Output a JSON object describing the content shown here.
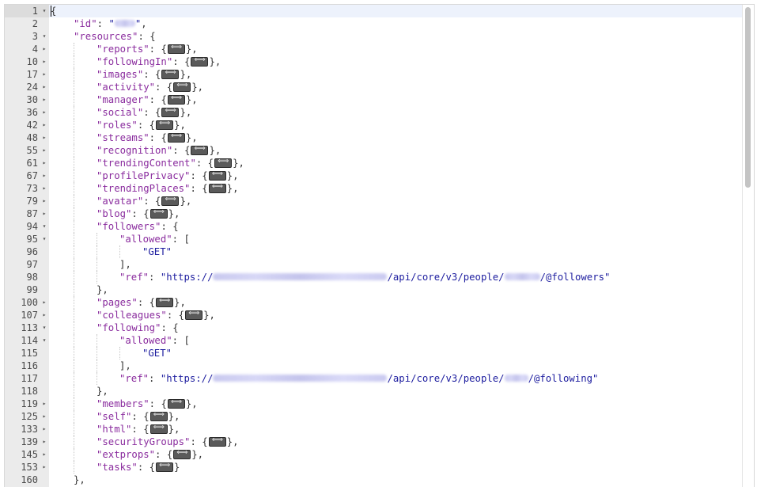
{
  "lines": [
    {
      "n": "1",
      "f": "v",
      "d": 0,
      "t": [
        [
          "p",
          "{"
        ]
      ],
      "active": true
    },
    {
      "n": "2",
      "d": 1,
      "t": [
        [
          "k",
          "\"id\""
        ],
        [
          "p",
          ": "
        ],
        [
          "s",
          "\""
        ],
        [
          "b",
          "redacted"
        ],
        [
          "s",
          "\""
        ],
        [
          "p",
          ","
        ]
      ]
    },
    {
      "n": "3",
      "f": "v",
      "d": 1,
      "t": [
        [
          "k",
          "\"resources\""
        ],
        [
          "p",
          ": {"
        ]
      ]
    },
    {
      "n": "4",
      "f": ">",
      "d": 2,
      "t": [
        [
          "k",
          "\"reports\""
        ],
        [
          "p",
          ": {"
        ],
        [
          "c",
          "collapsed"
        ],
        [
          "p",
          "},"
        ]
      ]
    },
    {
      "n": "10",
      "f": ">",
      "d": 2,
      "t": [
        [
          "k",
          "\"followingIn\""
        ],
        [
          "p",
          ": {"
        ],
        [
          "c",
          "collapsed"
        ],
        [
          "p",
          "},"
        ]
      ]
    },
    {
      "n": "17",
      "f": ">",
      "d": 2,
      "t": [
        [
          "k",
          "\"images\""
        ],
        [
          "p",
          ": {"
        ],
        [
          "c",
          "collapsed"
        ],
        [
          "p",
          "},"
        ]
      ]
    },
    {
      "n": "24",
      "f": ">",
      "d": 2,
      "t": [
        [
          "k",
          "\"activity\""
        ],
        [
          "p",
          ": {"
        ],
        [
          "c",
          "collapsed"
        ],
        [
          "p",
          "},"
        ]
      ]
    },
    {
      "n": "30",
      "f": ">",
      "d": 2,
      "t": [
        [
          "k",
          "\"manager\""
        ],
        [
          "p",
          ": {"
        ],
        [
          "c",
          "collapsed"
        ],
        [
          "p",
          "},"
        ]
      ]
    },
    {
      "n": "36",
      "f": ">",
      "d": 2,
      "t": [
        [
          "k",
          "\"social\""
        ],
        [
          "p",
          ": {"
        ],
        [
          "c",
          "collapsed"
        ],
        [
          "p",
          "},"
        ]
      ]
    },
    {
      "n": "42",
      "f": ">",
      "d": 2,
      "t": [
        [
          "k",
          "\"roles\""
        ],
        [
          "p",
          ": {"
        ],
        [
          "c",
          "collapsed"
        ],
        [
          "p",
          "},"
        ]
      ]
    },
    {
      "n": "48",
      "f": ">",
      "d": 2,
      "t": [
        [
          "k",
          "\"streams\""
        ],
        [
          "p",
          ": {"
        ],
        [
          "c",
          "collapsed"
        ],
        [
          "p",
          "},"
        ]
      ]
    },
    {
      "n": "55",
      "f": ">",
      "d": 2,
      "t": [
        [
          "k",
          "\"recognition\""
        ],
        [
          "p",
          ": {"
        ],
        [
          "c",
          "collapsed"
        ],
        [
          "p",
          "},"
        ]
      ]
    },
    {
      "n": "61",
      "f": ">",
      "d": 2,
      "t": [
        [
          "k",
          "\"trendingContent\""
        ],
        [
          "p",
          ": {"
        ],
        [
          "c",
          "collapsed"
        ],
        [
          "p",
          "},"
        ]
      ]
    },
    {
      "n": "67",
      "f": ">",
      "d": 2,
      "t": [
        [
          "k",
          "\"profilePrivacy\""
        ],
        [
          "p",
          ": {"
        ],
        [
          "c",
          "collapsed"
        ],
        [
          "p",
          "},"
        ]
      ]
    },
    {
      "n": "73",
      "f": ">",
      "d": 2,
      "t": [
        [
          "k",
          "\"trendingPlaces\""
        ],
        [
          "p",
          ": {"
        ],
        [
          "c",
          "collapsed"
        ],
        [
          "p",
          "},"
        ]
      ]
    },
    {
      "n": "79",
      "f": ">",
      "d": 2,
      "t": [
        [
          "k",
          "\"avatar\""
        ],
        [
          "p",
          ": {"
        ],
        [
          "c",
          "collapsed"
        ],
        [
          "p",
          "},"
        ]
      ]
    },
    {
      "n": "87",
      "f": ">",
      "d": 2,
      "t": [
        [
          "k",
          "\"blog\""
        ],
        [
          "p",
          ": {"
        ],
        [
          "c",
          "collapsed"
        ],
        [
          "p",
          "},"
        ]
      ]
    },
    {
      "n": "94",
      "f": "v",
      "d": 2,
      "t": [
        [
          "k",
          "\"followers\""
        ],
        [
          "p",
          ": {"
        ]
      ]
    },
    {
      "n": "95",
      "f": "v",
      "d": 3,
      "t": [
        [
          "k",
          "\"allowed\""
        ],
        [
          "p",
          ": ["
        ]
      ]
    },
    {
      "n": "96",
      "d": 4,
      "t": [
        [
          "s",
          "\"GET\""
        ]
      ]
    },
    {
      "n": "97",
      "d": 3,
      "t": [
        [
          "p",
          "],"
        ]
      ]
    },
    {
      "n": "98",
      "d": 3,
      "t": [
        [
          "k",
          "\"ref\""
        ],
        [
          "p",
          ": "
        ],
        [
          "s",
          "\"https://"
        ],
        [
          "b",
          "redacted"
        ],
        [
          "s",
          "/api/core/v3/people/"
        ],
        [
          "b",
          "redacted"
        ],
        [
          "s",
          "/@followers\""
        ]
      ]
    },
    {
      "n": "99",
      "d": 2,
      "t": [
        [
          "p",
          "},"
        ]
      ]
    },
    {
      "n": "100",
      "f": ">",
      "d": 2,
      "t": [
        [
          "k",
          "\"pages\""
        ],
        [
          "p",
          ": {"
        ],
        [
          "c",
          "collapsed"
        ],
        [
          "p",
          "},"
        ]
      ]
    },
    {
      "n": "107",
      "f": ">",
      "d": 2,
      "t": [
        [
          "k",
          "\"colleagues\""
        ],
        [
          "p",
          ": {"
        ],
        [
          "c",
          "collapsed"
        ],
        [
          "p",
          "},"
        ]
      ]
    },
    {
      "n": "113",
      "f": "v",
      "d": 2,
      "t": [
        [
          "k",
          "\"following\""
        ],
        [
          "p",
          ": {"
        ]
      ]
    },
    {
      "n": "114",
      "f": "v",
      "d": 3,
      "t": [
        [
          "k",
          "\"allowed\""
        ],
        [
          "p",
          ": ["
        ]
      ]
    },
    {
      "n": "115",
      "d": 4,
      "t": [
        [
          "s",
          "\"GET\""
        ]
      ]
    },
    {
      "n": "116",
      "d": 3,
      "t": [
        [
          "p",
          "],"
        ]
      ]
    },
    {
      "n": "117",
      "d": 3,
      "t": [
        [
          "k",
          "\"ref\""
        ],
        [
          "p",
          ": "
        ],
        [
          "s",
          "\"https://"
        ],
        [
          "b",
          "redacted"
        ],
        [
          "s",
          "/api/core/v3/people/"
        ],
        [
          "b",
          "redacted"
        ],
        [
          "s",
          "/@following\""
        ]
      ]
    },
    {
      "n": "118",
      "d": 2,
      "t": [
        [
          "p",
          "},"
        ]
      ]
    },
    {
      "n": "119",
      "f": ">",
      "d": 2,
      "t": [
        [
          "k",
          "\"members\""
        ],
        [
          "p",
          ": {"
        ],
        [
          "c",
          "collapsed"
        ],
        [
          "p",
          "},"
        ]
      ]
    },
    {
      "n": "125",
      "f": ">",
      "d": 2,
      "t": [
        [
          "k",
          "\"self\""
        ],
        [
          "p",
          ": {"
        ],
        [
          "c",
          "collapsed"
        ],
        [
          "p",
          "},"
        ]
      ]
    },
    {
      "n": "133",
      "f": ">",
      "d": 2,
      "t": [
        [
          "k",
          "\"html\""
        ],
        [
          "p",
          ": {"
        ],
        [
          "c",
          "collapsed"
        ],
        [
          "p",
          "},"
        ]
      ]
    },
    {
      "n": "139",
      "f": ">",
      "d": 2,
      "t": [
        [
          "k",
          "\"securityGroups\""
        ],
        [
          "p",
          ": {"
        ],
        [
          "c",
          "collapsed"
        ],
        [
          "p",
          "},"
        ]
      ]
    },
    {
      "n": "145",
      "f": ">",
      "d": 2,
      "t": [
        [
          "k",
          "\"extprops\""
        ],
        [
          "p",
          ": {"
        ],
        [
          "c",
          "collapsed"
        ],
        [
          "p",
          "},"
        ]
      ]
    },
    {
      "n": "153",
      "f": ">",
      "d": 2,
      "t": [
        [
          "k",
          "\"tasks\""
        ],
        [
          "p",
          ": {"
        ],
        [
          "c",
          "collapsed"
        ],
        [
          "p",
          "}"
        ]
      ]
    },
    {
      "n": "160",
      "d": 1,
      "t": [
        [
          "p",
          "},"
        ]
      ]
    }
  ]
}
